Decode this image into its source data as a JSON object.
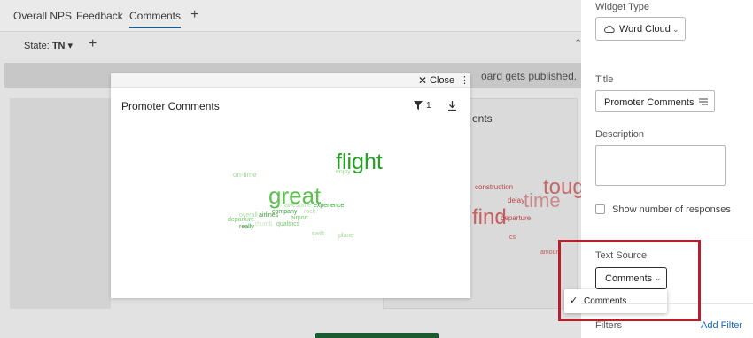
{
  "tabs": [
    {
      "label": "Overall NPS"
    },
    {
      "label": "Feedback"
    },
    {
      "label": "Comments",
      "active": true
    }
  ],
  "tab_add": "+",
  "state_filter": {
    "label": "State:",
    "value": "TN",
    "chevron": "▾"
  },
  "state_add": "+",
  "banner_text": "oard gets published.",
  "bg_tile": {
    "title": "ents",
    "words": [
      {
        "text": "toug",
        "color": "#c26a6a"
      },
      {
        "text": "time",
        "color": "#c98a8a"
      },
      {
        "text": "find",
        "color": "#c66060"
      },
      {
        "text": "construction",
        "color": "#b84444"
      },
      {
        "text": "delay",
        "color": "#b84444"
      },
      {
        "text": "departure",
        "color": "#b84444"
      },
      {
        "text": "cs",
        "color": "#c45555"
      },
      {
        "text": "amount",
        "color": "#c45555"
      }
    ]
  },
  "modal": {
    "close_icon": "close-icon",
    "close_label": "Close",
    "menu_glyph": "⋮",
    "title": "Promoter Comments",
    "filter_count": "1",
    "words": [
      {
        "text": "flight",
        "color": "#22a022"
      },
      {
        "text": "great",
        "color": "#5cc24e"
      },
      {
        "text": "on-time",
        "color": "#9fd893"
      },
      {
        "text": "enjoy",
        "color": "#9fd893"
      },
      {
        "text": "awesome",
        "color": "#a7dc9c"
      },
      {
        "text": "experience",
        "color": "#2e9c2e"
      },
      {
        "text": "company",
        "color": "#3f9a3f"
      },
      {
        "text": "rock",
        "color": "#a7dc9c"
      },
      {
        "text": "overall",
        "color": "#a7dc9c"
      },
      {
        "text": "airlines",
        "color": "#3f9a3f"
      },
      {
        "text": "airport",
        "color": "#7cc870"
      },
      {
        "text": "departure",
        "color": "#7cc870"
      },
      {
        "text": "really",
        "color": "#2e9c2e"
      },
      {
        "text": "thumb",
        "color": "#c6e8bf"
      },
      {
        "text": "qualtrics",
        "color": "#7cc870"
      },
      {
        "text": "swift",
        "color": "#9fd893"
      },
      {
        "text": "plane",
        "color": "#9fd893"
      }
    ]
  },
  "panel": {
    "widget_type_label": "Widget Type",
    "widget_type_value": "Word Cloud",
    "title_label": "Title",
    "title_value": "Promoter Comments",
    "description_label": "Description",
    "show_responses_label": "Show number of responses",
    "text_source_label": "Text Source",
    "text_source_value": "Comments",
    "dropdown_option": "Comments",
    "filters_label": "Filters",
    "add_filter": "Add Filter"
  }
}
